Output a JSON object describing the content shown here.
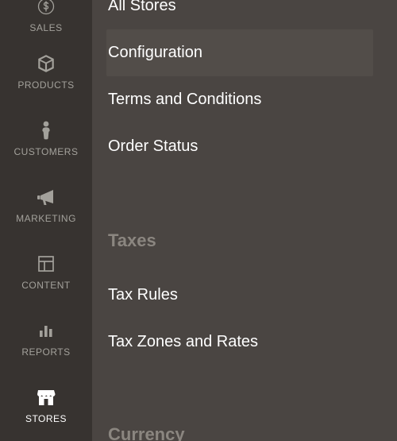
{
  "sidebar": {
    "items": [
      {
        "label": "SALES",
        "icon": "dollar"
      },
      {
        "label": "PRODUCTS",
        "icon": "box"
      },
      {
        "label": "CUSTOMERS",
        "icon": "person"
      },
      {
        "label": "MARKETING",
        "icon": "megaphone"
      },
      {
        "label": "CONTENT",
        "icon": "layout"
      },
      {
        "label": "REPORTS",
        "icon": "bars"
      },
      {
        "label": "STORES",
        "icon": "store",
        "active": true
      }
    ]
  },
  "panel": {
    "section1_items": [
      {
        "label": "All Stores"
      },
      {
        "label": "Configuration",
        "active": true
      },
      {
        "label": "Terms and Conditions"
      },
      {
        "label": "Order Status"
      }
    ],
    "section2_heading": "Taxes",
    "section2_items": [
      {
        "label": "Tax Rules"
      },
      {
        "label": "Tax Zones and Rates"
      }
    ],
    "section3_heading": "Currency"
  }
}
